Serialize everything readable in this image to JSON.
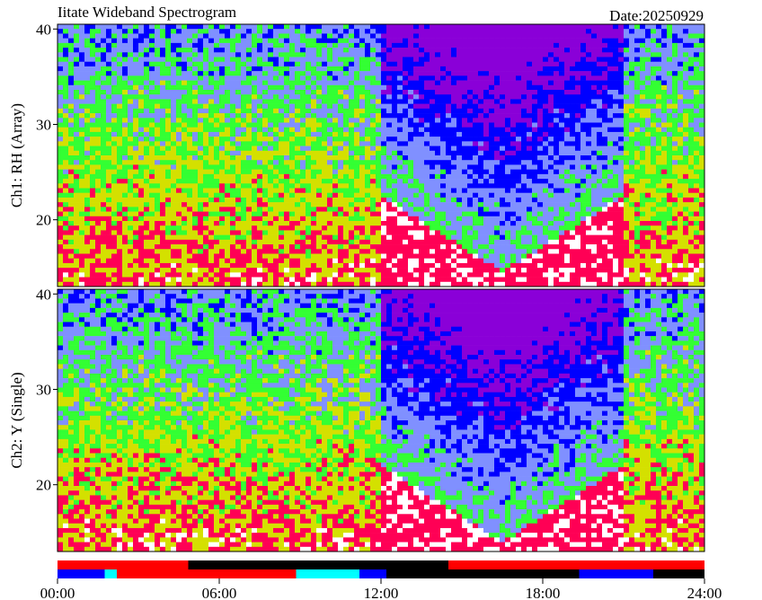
{
  "header": {
    "title": "Iitate Wideband Spectrogram",
    "date": "Date:20250929"
  },
  "chart_data": {
    "type": "heatmap",
    "x_axis": {
      "range": [
        "00:00",
        "24:00"
      ],
      "ticks": [
        "00:00",
        "06:00",
        "12:00",
        "18:00",
        "24:00"
      ],
      "tick_hours": [
        0,
        6,
        12,
        18,
        24
      ]
    },
    "panels": [
      {
        "ylabel": "Ch1: RH (Array)",
        "ylim": [
          13,
          40.5
        ],
        "yticks": [
          20,
          30,
          40
        ],
        "dark_region": {
          "start_hour": 12.0,
          "end_hour": 21.0,
          "min_freq": 14.5
        }
      },
      {
        "ylabel": "Ch2: Y (Single)",
        "ylim": [
          13,
          40.5
        ],
        "yticks": [
          20,
          30,
          40
        ],
        "dark_region": {
          "start_hour": 12.0,
          "end_hour": 21.0,
          "min_freq": 14.0
        }
      }
    ],
    "status_bar": {
      "upper_segments": [
        {
          "start_hour": 0.0,
          "end_hour": 4.85,
          "color": "#ff0000"
        },
        {
          "start_hour": 4.85,
          "end_hour": 14.5,
          "color": "#000000"
        },
        {
          "start_hour": 14.5,
          "end_hour": 24.0,
          "color": "#ff0000"
        }
      ],
      "lower_segments": [
        {
          "start_hour": 0.0,
          "end_hour": 1.75,
          "color": "#0000ff"
        },
        {
          "start_hour": 1.75,
          "end_hour": 2.2,
          "color": "#00ffff"
        },
        {
          "start_hour": 2.2,
          "end_hour": 8.85,
          "color": "#ff0000"
        },
        {
          "start_hour": 8.85,
          "end_hour": 11.2,
          "color": "#00ffff"
        },
        {
          "start_hour": 11.2,
          "end_hour": 12.2,
          "color": "#0000ff"
        },
        {
          "start_hour": 12.2,
          "end_hour": 19.35,
          "color": "#000000"
        },
        {
          "start_hour": 19.35,
          "end_hour": 22.1,
          "color": "#0000ff"
        },
        {
          "start_hour": 22.1,
          "end_hour": 24.0,
          "color": "#000000"
        }
      ]
    },
    "colors": {
      "palette": [
        "#ffffff",
        "#ff0055",
        "#d4e000",
        "#33ff33",
        "#8090ff",
        "#0000ff",
        "#8a00d8"
      ]
    }
  }
}
